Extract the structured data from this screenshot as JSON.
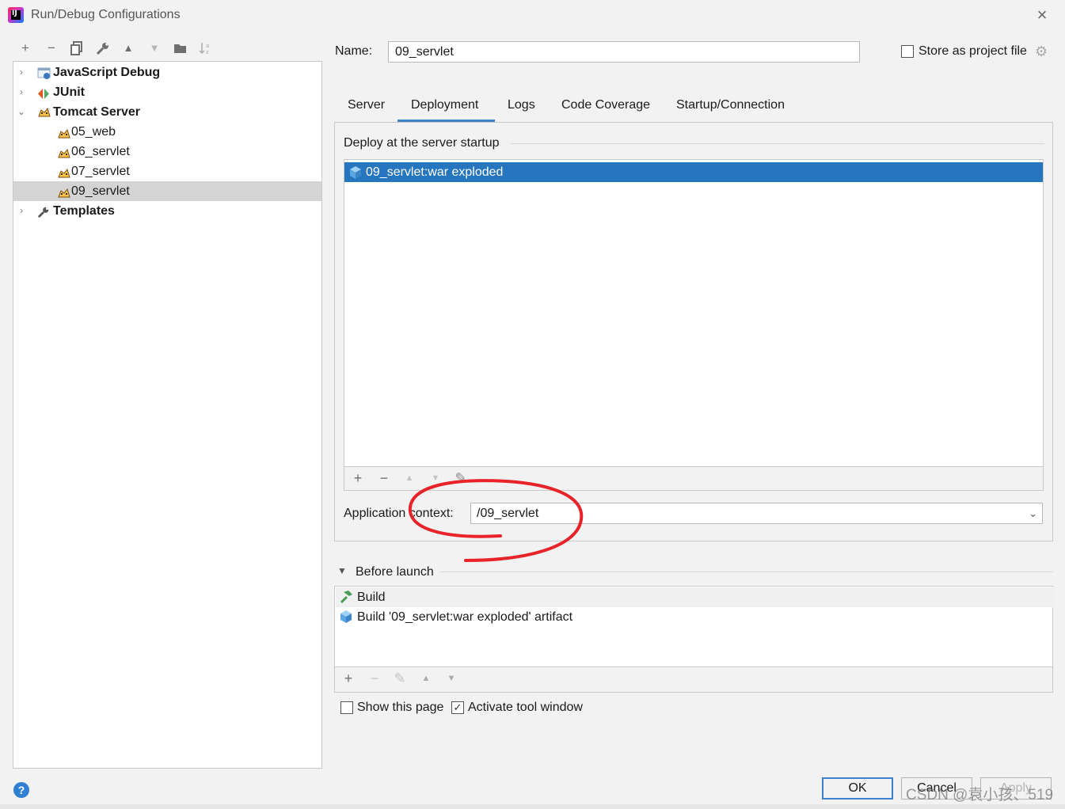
{
  "window": {
    "title": "Run/Debug Configurations",
    "close_icon": "×"
  },
  "toolbar": {
    "add": "+",
    "remove": "−",
    "copy": "⧉",
    "edit": "🔧",
    "up": "▲",
    "down": "▼",
    "folder": "📁",
    "sort": "↓a z"
  },
  "tree": {
    "items": [
      {
        "label": "JavaScript Debug",
        "bold": true,
        "expand": "›"
      },
      {
        "label": "JUnit",
        "bold": true,
        "expand": "›"
      },
      {
        "label": "Tomcat Server",
        "bold": true,
        "expand": "⌄"
      },
      {
        "label": "05_web"
      },
      {
        "label": "06_servlet"
      },
      {
        "label": "07_servlet"
      },
      {
        "label": "09_servlet",
        "selected": true
      },
      {
        "label": "Templates",
        "bold": true,
        "expand": "›"
      }
    ]
  },
  "config": {
    "name_label": "Name:",
    "name_value": "09_servlet",
    "store_label": "Store as project file",
    "store_checked": false
  },
  "tabs": [
    {
      "label": "Server"
    },
    {
      "label": "Deployment",
      "active": true
    },
    {
      "label": "Logs"
    },
    {
      "label": "Code Coverage"
    },
    {
      "label": "Startup/Connection"
    }
  ],
  "deployment": {
    "section_title": "Deploy at the server startup",
    "items": [
      {
        "label": "09_servlet:war exploded",
        "selected": true
      }
    ],
    "toolbar": {
      "add": "+",
      "remove": "−",
      "up": "▲",
      "down": "▼",
      "edit": "✎"
    },
    "context_label": "Application context:",
    "context_value": "/09_servlet",
    "context_dropdown_icon": "⌄"
  },
  "before_launch": {
    "title": "Before launch",
    "collapse_icon": "▼",
    "items": [
      {
        "label": "Build",
        "icon": "hammer-icon"
      },
      {
        "label": "Build '09_servlet:war exploded' artifact",
        "icon": "artifact-icon"
      }
    ],
    "toolbar": {
      "add": "+",
      "remove": "−",
      "edit": "✎",
      "up": "▲",
      "down": "▼"
    }
  },
  "options": {
    "show_page_label": "Show this page",
    "show_page_checked": false,
    "activate_label": "Activate tool window",
    "activate_checked": true
  },
  "footer": {
    "help": "?",
    "ok": "OK",
    "cancel": "Cancel",
    "apply": "Apply",
    "watermark": "CSDN @袁小孩、519"
  },
  "colors": {
    "selection": "#2675bf",
    "tab_underline": "#4083c9",
    "annotation_circle": "#e8232a"
  }
}
